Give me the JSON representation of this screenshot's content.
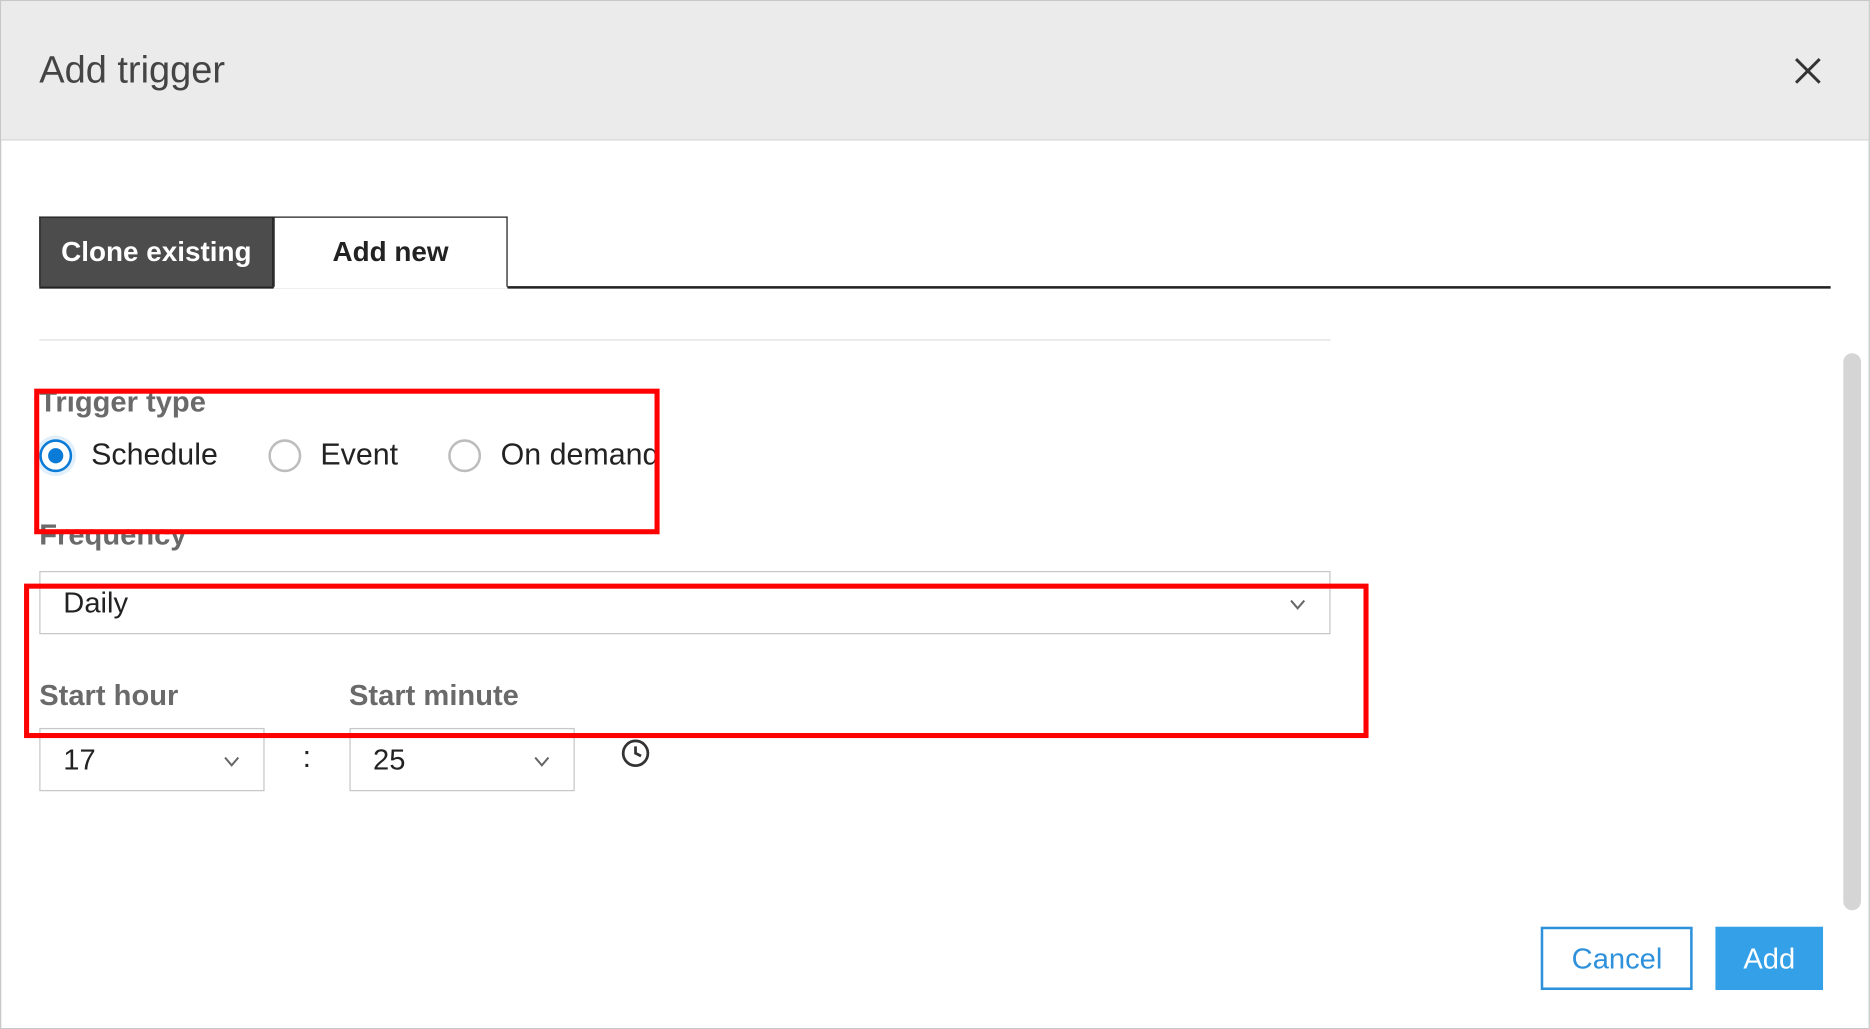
{
  "header": {
    "title": "Add trigger"
  },
  "tabs": {
    "clone": "Clone existing",
    "addnew": "Add new"
  },
  "trigger_type": {
    "label": "Trigger type",
    "options": {
      "schedule": "Schedule",
      "event": "Event",
      "on_demand": "On demand"
    },
    "selected": "schedule"
  },
  "frequency": {
    "label": "Frequency",
    "value": "Daily"
  },
  "start_hour": {
    "label": "Start hour",
    "value": "17"
  },
  "start_minute": {
    "label": "Start minute",
    "value": "25"
  },
  "time_separator": ":",
  "buttons": {
    "cancel": "Cancel",
    "add": "Add"
  }
}
